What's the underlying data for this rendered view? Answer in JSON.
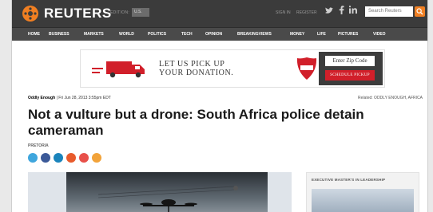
{
  "header": {
    "logo_text": "REUTERS",
    "edition_label": "EDITION:",
    "edition_value": "U.S.",
    "sign_in": "SIGN IN",
    "register": "REGISTER",
    "search_placeholder": "Search Reuters",
    "colors": {
      "bar": "#3b3b3b",
      "accent": "#f07f22"
    },
    "social_icons": [
      "twitter-icon",
      "facebook-icon",
      "linkedin-icon"
    ]
  },
  "nav": {
    "items": [
      "HOME",
      "BUSINESS",
      "MARKETS",
      "WORLD",
      "POLITICS",
      "TECH",
      "OPINION",
      "BREAKINGVIEWS",
      "MONEY",
      "LIFE",
      "PICTURES",
      "VIDEO"
    ]
  },
  "ad": {
    "line1": "LET US PICK UP",
    "line2": "YOUR DONATION.",
    "zip_placeholder": "Enter Zip Code",
    "button_label": "SCHEDULE PICKUP",
    "brand_colors": {
      "red": "#d11f2a"
    }
  },
  "article": {
    "section": "Oddly Enough",
    "timestamp": "Fri Jun 28, 2013 3:55pm EDT",
    "related": "Related: ODDLY ENOUGH, AFRICA",
    "headline": "Not a vulture but a drone: South Africa police detain cameraman",
    "dateline": "PRETORIA",
    "share_icons": [
      "twitter-icon",
      "facebook-icon",
      "linkedin-icon",
      "reddit-icon",
      "google-plus-icon",
      "email-icon"
    ]
  },
  "sidebar": {
    "title": "EXECUTIVE MASTER'S IN LEADERSHIP"
  }
}
